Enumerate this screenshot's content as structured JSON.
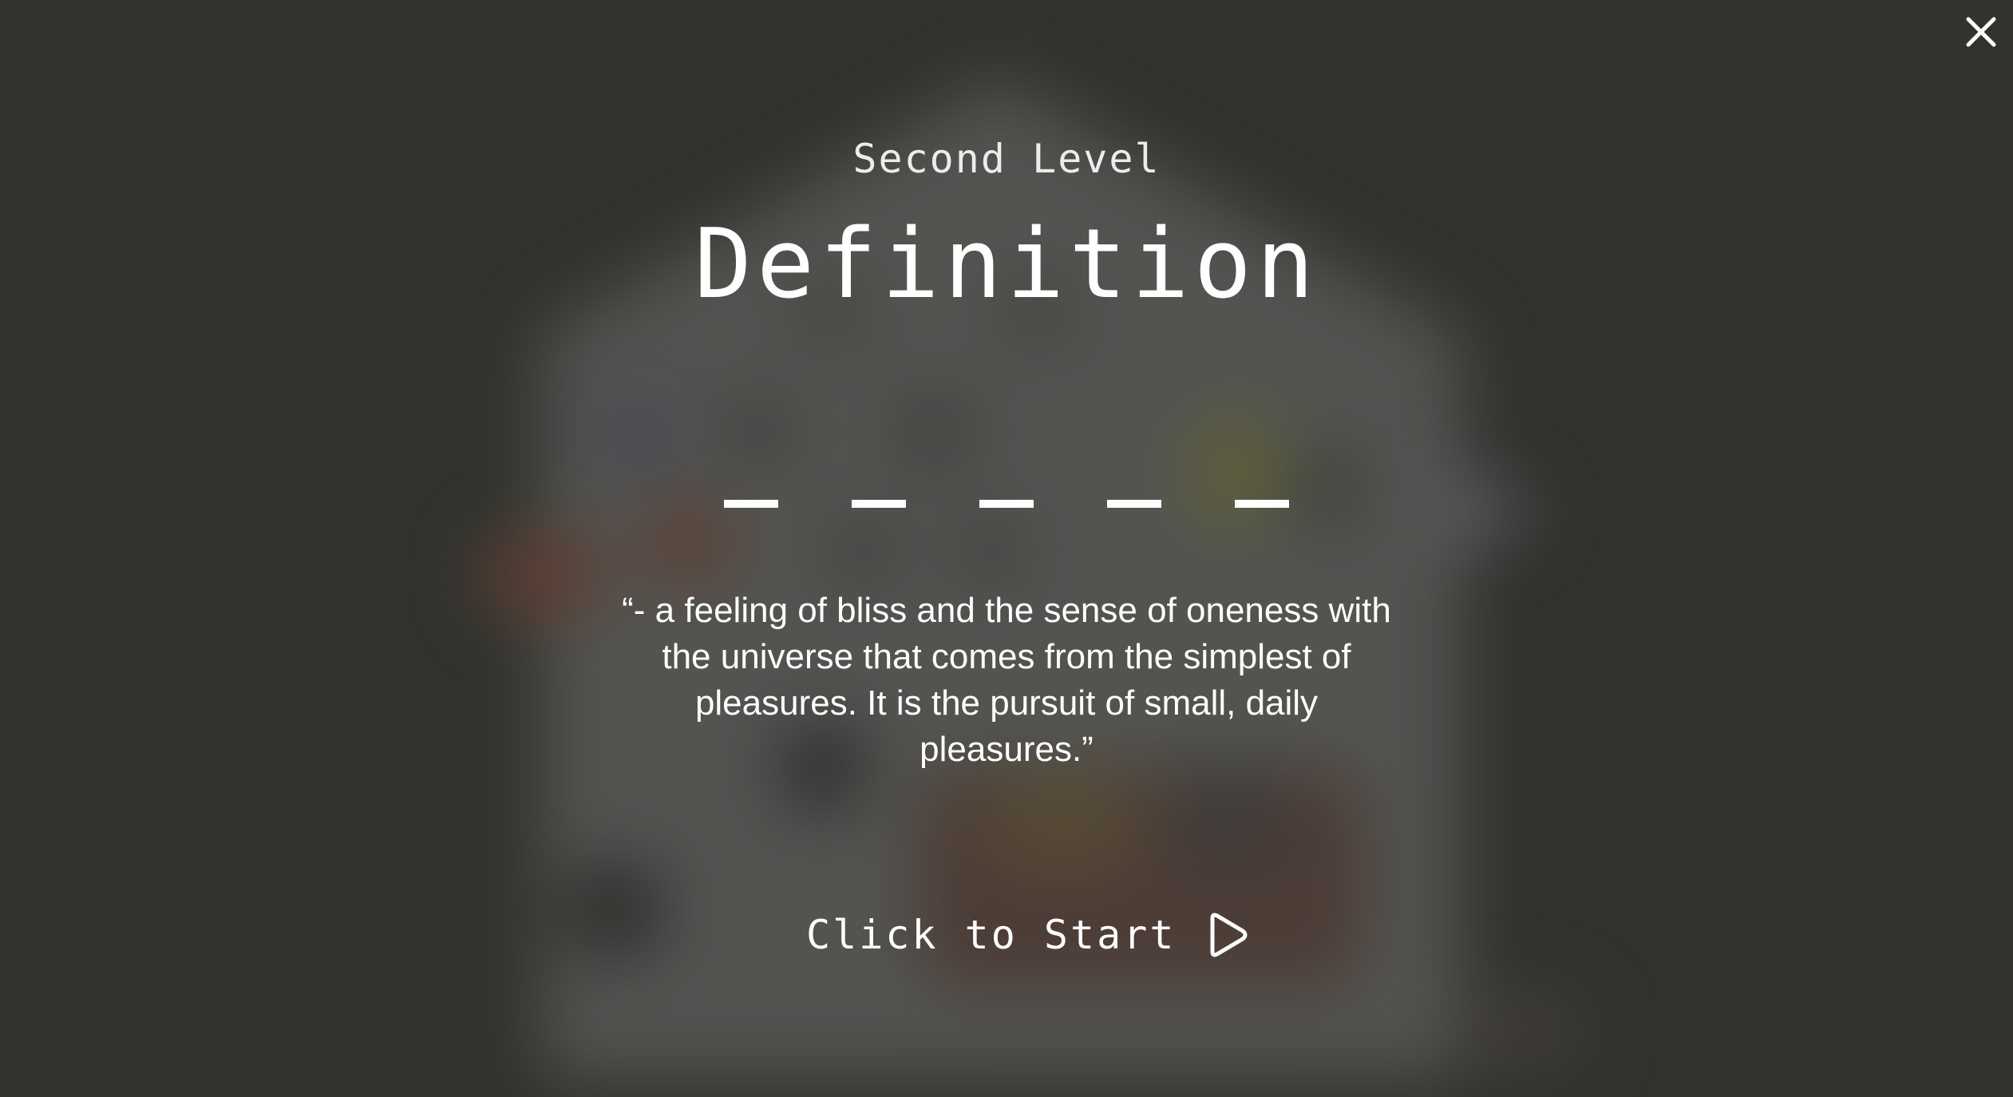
{
  "level": {
    "subtitle": "Second Level",
    "title": "Definition",
    "blank_count": 5
  },
  "definition": {
    "text": "“- a feeling of bliss and the sense of oneness with the universe that comes from the simplest of pleasures. It is the pursuit of small, daily pleasures.”"
  },
  "start": {
    "label": "Click to Start",
    "icon": "play-icon"
  },
  "close": {
    "icon": "close-icon"
  },
  "colors": {
    "background": "#363834",
    "text": "#ffffff",
    "house_wall": "#6b6b69"
  }
}
